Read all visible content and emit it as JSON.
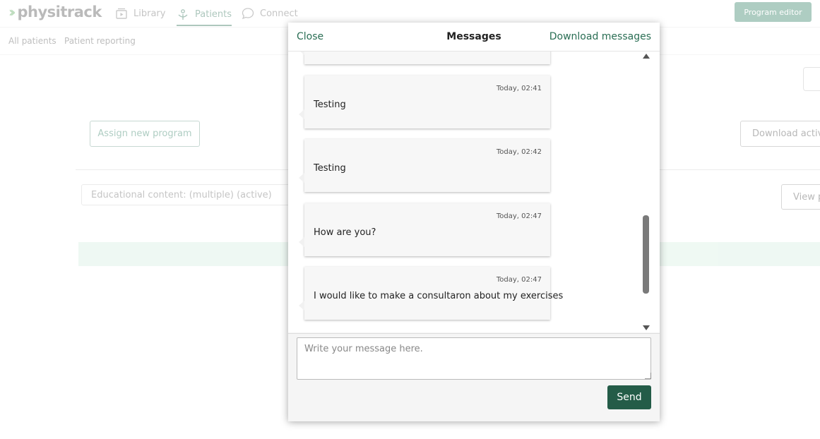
{
  "app": {
    "logo_text": "physitrack",
    "nav": [
      {
        "label": "Library",
        "icon": "library-icon"
      },
      {
        "label": "Patients",
        "icon": "patients-icon",
        "active": true
      },
      {
        "label": "Connect",
        "icon": "chat-icon"
      }
    ],
    "program_editor_label": "Program editor"
  },
  "subnav": {
    "items": [
      "All patients",
      "Patient reporting"
    ]
  },
  "page": {
    "assign_label": "Assign new program",
    "download_activity_label": "Download activi",
    "filter_value": "Educational content: (multiple) (active)",
    "view_label": "View p"
  },
  "modal": {
    "close_label": "Close",
    "title": "Messages",
    "download_label": "Download messages",
    "messages": [
      {
        "time": "Today, 02:41",
        "text": "Testing"
      },
      {
        "time": "Today, 02:42",
        "text": "Testing"
      },
      {
        "time": "Today, 02:47",
        "text": "How are you?"
      },
      {
        "time": "Today, 02:47",
        "text": "I would like to make a consultaron about my exercises"
      }
    ],
    "compose_placeholder": "Write your message here.",
    "send_label": "Send"
  },
  "colors": {
    "accent": "#2a6e54",
    "send_button": "#245c48"
  }
}
